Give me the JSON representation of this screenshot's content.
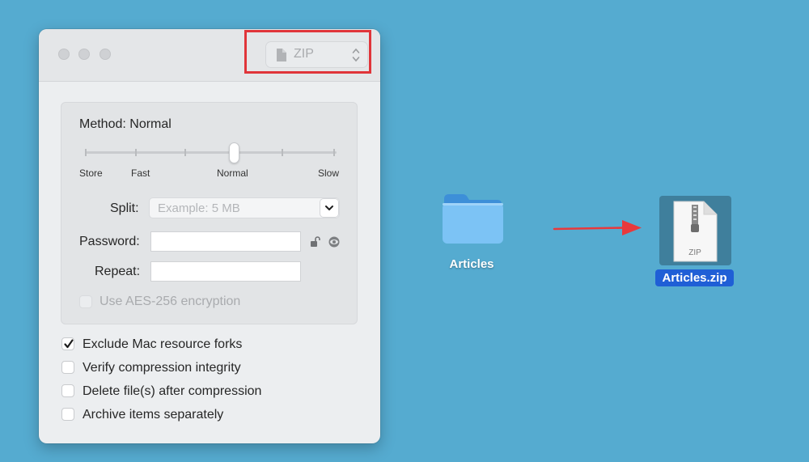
{
  "window": {
    "format": {
      "label": "ZIP",
      "icon": "document-icon",
      "highlight_color": "#e0353a"
    },
    "method": {
      "label": "Method: Normal",
      "slider_levels": [
        "Store",
        "Fast",
        "Normal",
        "Slow"
      ],
      "selected": "Normal"
    },
    "split": {
      "label": "Split:",
      "placeholder": "Example: 5 MB",
      "value": ""
    },
    "password": {
      "label": "Password:",
      "value": ""
    },
    "repeat": {
      "label": "Repeat:",
      "value": ""
    },
    "aes": {
      "label": "Use AES-256 encryption",
      "checked": false,
      "enabled": false
    },
    "options": [
      {
        "label": "Exclude Mac resource forks",
        "checked": true
      },
      {
        "label": "Verify compression integrity",
        "checked": false
      },
      {
        "label": "Delete file(s) after compression",
        "checked": false
      },
      {
        "label": "Archive items separately",
        "checked": false
      }
    ]
  },
  "desktop": {
    "folder": {
      "name": "Articles",
      "icon": "folder-icon"
    },
    "archive": {
      "name": "Articles.zip",
      "icon": "zip-file-icon",
      "badge": "ZIP"
    },
    "arrow_color": "#e8393c"
  }
}
